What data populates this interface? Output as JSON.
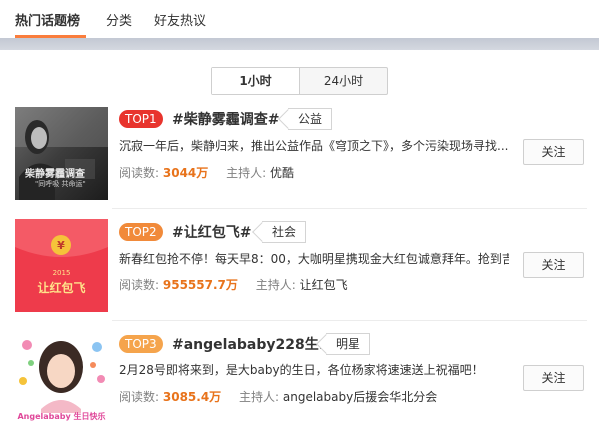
{
  "tabs": [
    "热门话题榜",
    "分类",
    "好友热议"
  ],
  "time_switch": [
    "1小时",
    "24小时"
  ],
  "items": [
    {
      "rank": "TOP1",
      "rank_color": "#e8342d",
      "title": "#柴静雾霾调查#",
      "tag": "公益",
      "desc": "沉寂一年后，柴静归来，推出公益作品《穹顶之下》，多个污染现场寻找...",
      "read_label": "阅读数:",
      "read_count": "3044万",
      "host_label": "主持人:",
      "host": "优酷",
      "follow": "关注",
      "thumb_text": "柴静雾霾调查",
      "thumb_sub": "\"同呼吸 共命运\""
    },
    {
      "rank": "TOP2",
      "rank_color": "#f18a3a",
      "title": "#让红包飞#",
      "tag": "社会",
      "desc": "新春红包抢不停！每天早8：00，大咖明星携现金大红包诚意拜年。抢到吉...",
      "read_label": "阅读数:",
      "read_count": "955557.7万",
      "host_label": "主持人:",
      "host": "让红包飞",
      "follow": "关注",
      "thumb_text": "让红包飞",
      "thumb_sub": "2015"
    },
    {
      "rank": "TOP3",
      "rank_color": "#f5a44c",
      "title": "#angelababy228生...",
      "tag": "明星",
      "desc": "2月28号即将来到，是大baby的生日，各位杨家将速速送上祝福吧！",
      "read_label": "阅读数:",
      "read_count": "3085.4万",
      "host_label": "主持人:",
      "host": "angelababy后援会华北分会",
      "follow": "关注",
      "thumb_text": "Angelababy 生日快乐"
    }
  ]
}
